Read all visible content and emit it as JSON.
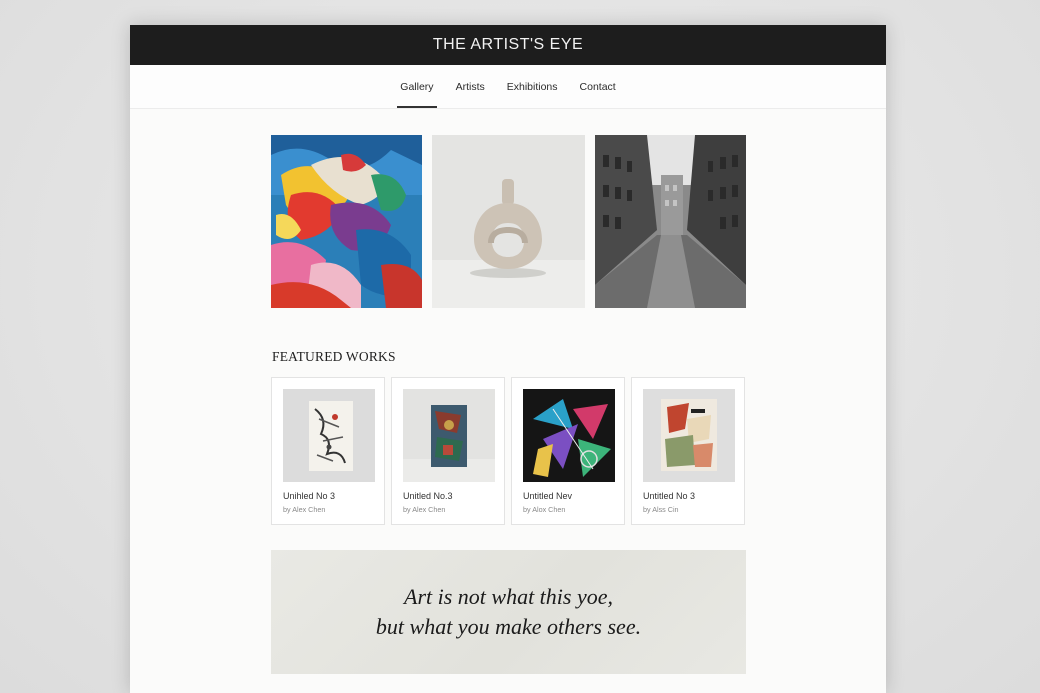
{
  "header": {
    "site_title": "THE ARTIST'S EYE"
  },
  "nav": {
    "items": [
      {
        "label": "Gallery",
        "active": true
      },
      {
        "label": "Artists",
        "active": false
      },
      {
        "label": "Exhibitions",
        "active": false
      },
      {
        "label": "Contact",
        "active": false
      }
    ]
  },
  "hero": {
    "images": [
      {
        "subject": "abstract colorful painting"
      },
      {
        "subject": "ceramic ring vase sculpture"
      },
      {
        "subject": "black and white city street photograph"
      }
    ]
  },
  "featured": {
    "heading": "FEATURED WORKS",
    "cards": [
      {
        "title": "Unihled No 3",
        "artist": "by Alex Chen"
      },
      {
        "title": "Unitled No.3",
        "artist": "by Alex Chen"
      },
      {
        "title": "Untitled Nev",
        "artist": "by Alox Chen"
      },
      {
        "title": "Untitled No 3",
        "artist": "by Alss Cin"
      }
    ]
  },
  "quote": {
    "line1": "Art is not what this yoe,",
    "line2": "but what you make others see."
  },
  "colors": {
    "topbar": "#1d1d1d",
    "page": "#fbfbfa",
    "quote_band": "#e6e6e1"
  }
}
